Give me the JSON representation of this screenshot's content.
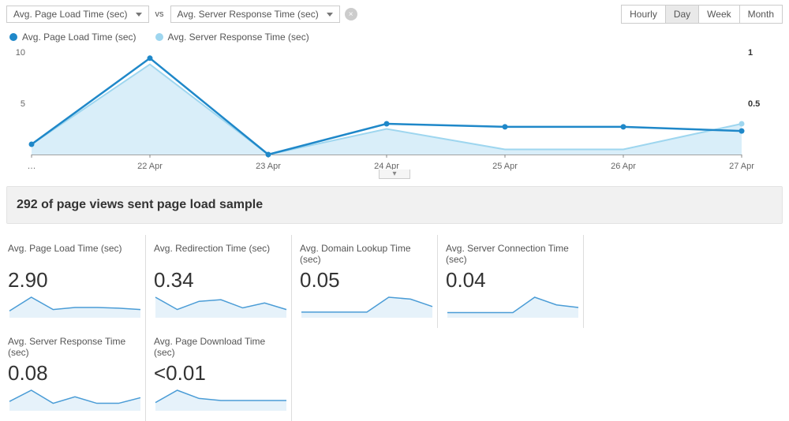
{
  "selectors": {
    "metric_a": "Avg. Page Load Time (sec)",
    "vs_label": "vs",
    "metric_b": "Avg. Server Response Time (sec)"
  },
  "period": {
    "options": [
      "Hourly",
      "Day",
      "Week",
      "Month"
    ],
    "active": "Day"
  },
  "legend": {
    "a": {
      "label": "Avg. Page Load Time (sec)",
      "color": "#1f88c9"
    },
    "b": {
      "label": "Avg. Server Response Time (sec)",
      "color": "#9ed6ef"
    }
  },
  "summary_text": "292 of page views sent page load sample",
  "chart_data": {
    "type": "line",
    "categories": [
      "…",
      "22 Apr",
      "23 Apr",
      "24 Apr",
      "25 Apr",
      "26 Apr",
      "27 Apr"
    ],
    "series": [
      {
        "name": "Avg. Page Load Time (sec)",
        "axis": "left",
        "color": "#1f88c9",
        "values": [
          1.0,
          9.4,
          0.0,
          3.0,
          2.7,
          2.7,
          2.3
        ]
      },
      {
        "name": "Avg. Server Response Time (sec)",
        "axis": "right",
        "color": "#9ed6ef",
        "values": [
          0.1,
          0.88,
          0.0,
          0.25,
          0.05,
          0.05,
          0.3
        ]
      }
    ],
    "left_axis": {
      "ticks": [
        5,
        10
      ],
      "min": 0,
      "max": 10
    },
    "right_axis": {
      "ticks": [
        0.5,
        1
      ],
      "min": 0,
      "max": 1
    }
  },
  "cards": [
    {
      "label": "Avg. Page Load Time (sec)",
      "value": "2.90",
      "spark": [
        1.0,
        3.0,
        1.2,
        1.5,
        1.5,
        1.4,
        1.2
      ]
    },
    {
      "label": "Avg. Redirection Time (sec)",
      "value": "0.34",
      "spark": [
        2.5,
        1.0,
        2.0,
        2.2,
        1.2,
        1.8,
        1.0
      ]
    },
    {
      "label": "Avg. Domain Lookup Time (sec)",
      "value": "0.05",
      "spark": [
        0.6,
        0.6,
        0.6,
        0.6,
        2.2,
        2.0,
        1.2
      ]
    },
    {
      "label": "Avg. Server Connection Time (sec)",
      "value": "0.04",
      "spark": [
        0.6,
        0.6,
        0.6,
        0.6,
        2.4,
        1.5,
        1.2
      ]
    },
    {
      "label": "Avg. Server Response Time (sec)",
      "value": "0.08",
      "spark": [
        1.0,
        2.2,
        0.8,
        1.5,
        0.8,
        0.8,
        1.4
      ]
    },
    {
      "label": "Avg. Page Download Time (sec)",
      "value": "<0.01",
      "spark": [
        0.4,
        1.0,
        0.6,
        0.5,
        0.5,
        0.5,
        0.5
      ]
    }
  ]
}
